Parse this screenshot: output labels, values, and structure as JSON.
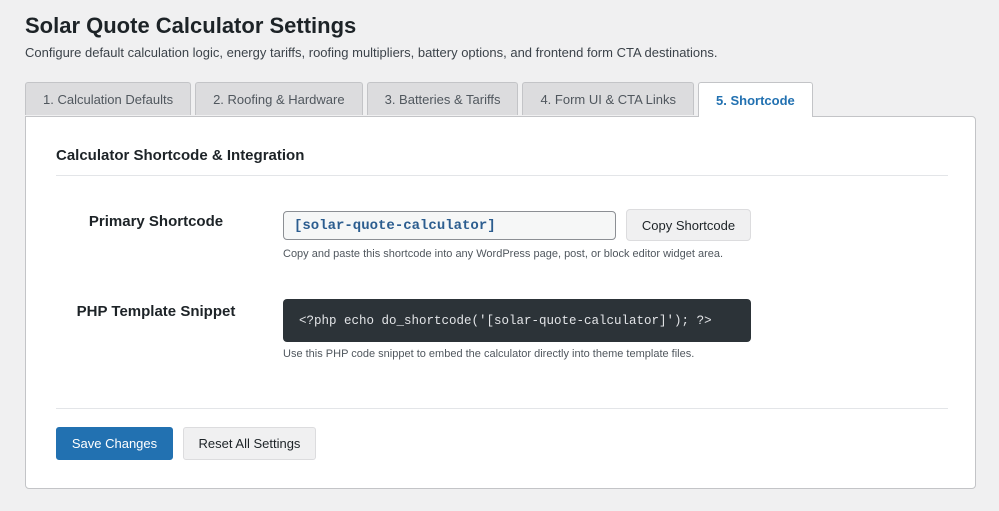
{
  "page": {
    "title": "Solar Quote Calculator Settings",
    "description": "Configure default calculation logic, energy tariffs, roofing multipliers, battery options, and frontend form CTA destinations."
  },
  "tabs": [
    {
      "label": "1. Calculation Defaults",
      "active": false
    },
    {
      "label": "2. Roofing & Hardware",
      "active": false
    },
    {
      "label": "3. Batteries & Tariffs",
      "active": false
    },
    {
      "label": "4. Form UI & CTA Links",
      "active": false
    },
    {
      "label": "5. Shortcode",
      "active": true
    }
  ],
  "section": {
    "title": "Calculator Shortcode & Integration"
  },
  "primary_shortcode": {
    "label": "Primary Shortcode",
    "value": "[solar-quote-calculator]",
    "copy_button": "Copy Shortcode",
    "help": "Copy and paste this shortcode into any WordPress page, post, or block editor widget area."
  },
  "php_snippet": {
    "label": "PHP Template Snippet",
    "code": "<?php echo do_shortcode('[solar-quote-calculator]'); ?>",
    "help": "Use this PHP code snippet to embed the calculator directly into theme template files."
  },
  "actions": {
    "save": "Save Changes",
    "reset": "Reset All Settings"
  },
  "colors": {
    "primary": "#2271b1",
    "background": "#f0f0f1",
    "code_background": "#2c3338"
  }
}
